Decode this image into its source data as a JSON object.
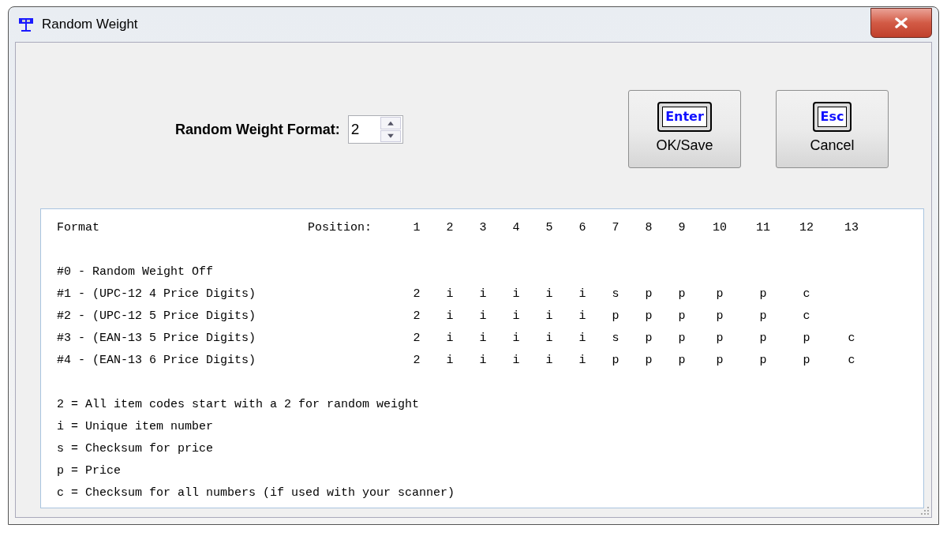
{
  "window": {
    "title": "Random Weight"
  },
  "format_field": {
    "label": "Random Weight Format:",
    "value": "2"
  },
  "buttons": [
    {
      "key_label": "Enter",
      "label": "OK/Save"
    },
    {
      "key_label": "Esc",
      "label": "Cancel"
    }
  ],
  "table": {
    "format_label": "Format",
    "position_label": "Position:",
    "positions": [
      "1",
      "2",
      "3",
      "4",
      "5",
      "6",
      "7",
      "8",
      "9",
      "10",
      "11",
      "12",
      "13"
    ],
    "rows": [
      {
        "name": "#0 - Random Weight Off",
        "codes": []
      },
      {
        "name": "#1 - (UPC-12 4 Price Digits)",
        "codes": [
          "2",
          "i",
          "i",
          "i",
          "i",
          "i",
          "s",
          "p",
          "p",
          "p",
          "p",
          "c"
        ]
      },
      {
        "name": "#2 - (UPC-12 5 Price Digits)",
        "codes": [
          "2",
          "i",
          "i",
          "i",
          "i",
          "i",
          "p",
          "p",
          "p",
          "p",
          "p",
          "c"
        ]
      },
      {
        "name": "#3 - (EAN-13 5 Price Digits)",
        "codes": [
          "2",
          "i",
          "i",
          "i",
          "i",
          "i",
          "s",
          "p",
          "p",
          "p",
          "p",
          "p",
          "c"
        ]
      },
      {
        "name": "#4 - (EAN-13 6 Price Digits)",
        "codes": [
          "2",
          "i",
          "i",
          "i",
          "i",
          "i",
          "p",
          "p",
          "p",
          "p",
          "p",
          "p",
          "c"
        ]
      }
    ]
  },
  "legend": [
    "2 = All item codes start with a 2 for random weight",
    "i = Unique item number",
    "s = Checksum for price",
    "p = Price",
    "c = Checksum for all numbers (if used with your scanner)"
  ]
}
